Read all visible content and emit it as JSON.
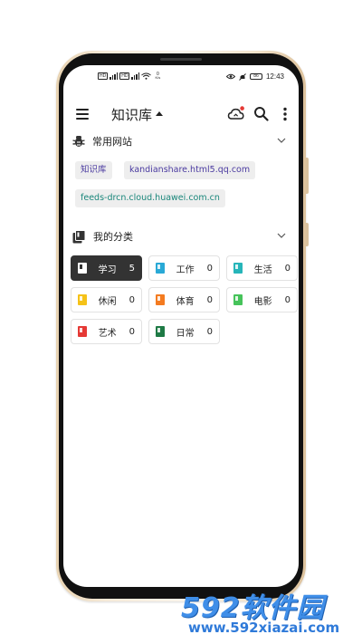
{
  "status_bar": {
    "left_tags": [
      "HD",
      "HD"
    ],
    "speed_value": "0",
    "speed_unit": "K/s",
    "battery": "86",
    "time": "12:43"
  },
  "app_bar": {
    "title": "知识库",
    "icons": [
      "menu-icon",
      "cloud-sync-icon",
      "search-icon",
      "more-vert-icon"
    ],
    "badge_color": "#e53935"
  },
  "sites_section": {
    "title": "常用网站",
    "icon": "bug-icon",
    "chips": [
      {
        "label": "知识库",
        "text_color": "#4a3aa0",
        "bg": "#eeeeee"
      },
      {
        "label": "kandianshare.html5.qq.com",
        "text_color": "#4a3aa0",
        "bg": "#eeeeee"
      },
      {
        "label": "feeds-drcn.cloud.huawei.com.cn",
        "text_color": "#19867a",
        "bg": "#eeeeee"
      }
    ]
  },
  "categories_section": {
    "title": "我的分类",
    "icon": "books-icon",
    "items": [
      {
        "label": "学习",
        "count": "5",
        "color": "#ffffff",
        "active": true
      },
      {
        "label": "工作",
        "count": "0",
        "color": "#29a9d6",
        "active": false
      },
      {
        "label": "生活",
        "count": "0",
        "color": "#26b5b9",
        "active": false
      },
      {
        "label": "休闲",
        "count": "0",
        "color": "#f5c218",
        "active": false
      },
      {
        "label": "体育",
        "count": "0",
        "color": "#f47b20",
        "active": false
      },
      {
        "label": "电影",
        "count": "0",
        "color": "#46c35a",
        "active": false
      },
      {
        "label": "艺术",
        "count": "0",
        "color": "#e53935",
        "active": false
      },
      {
        "label": "日常",
        "count": "0",
        "color": "#1e7a45",
        "active": false
      }
    ]
  },
  "watermark": {
    "main": "592软件园",
    "sub": "www.592xiazai.com"
  }
}
